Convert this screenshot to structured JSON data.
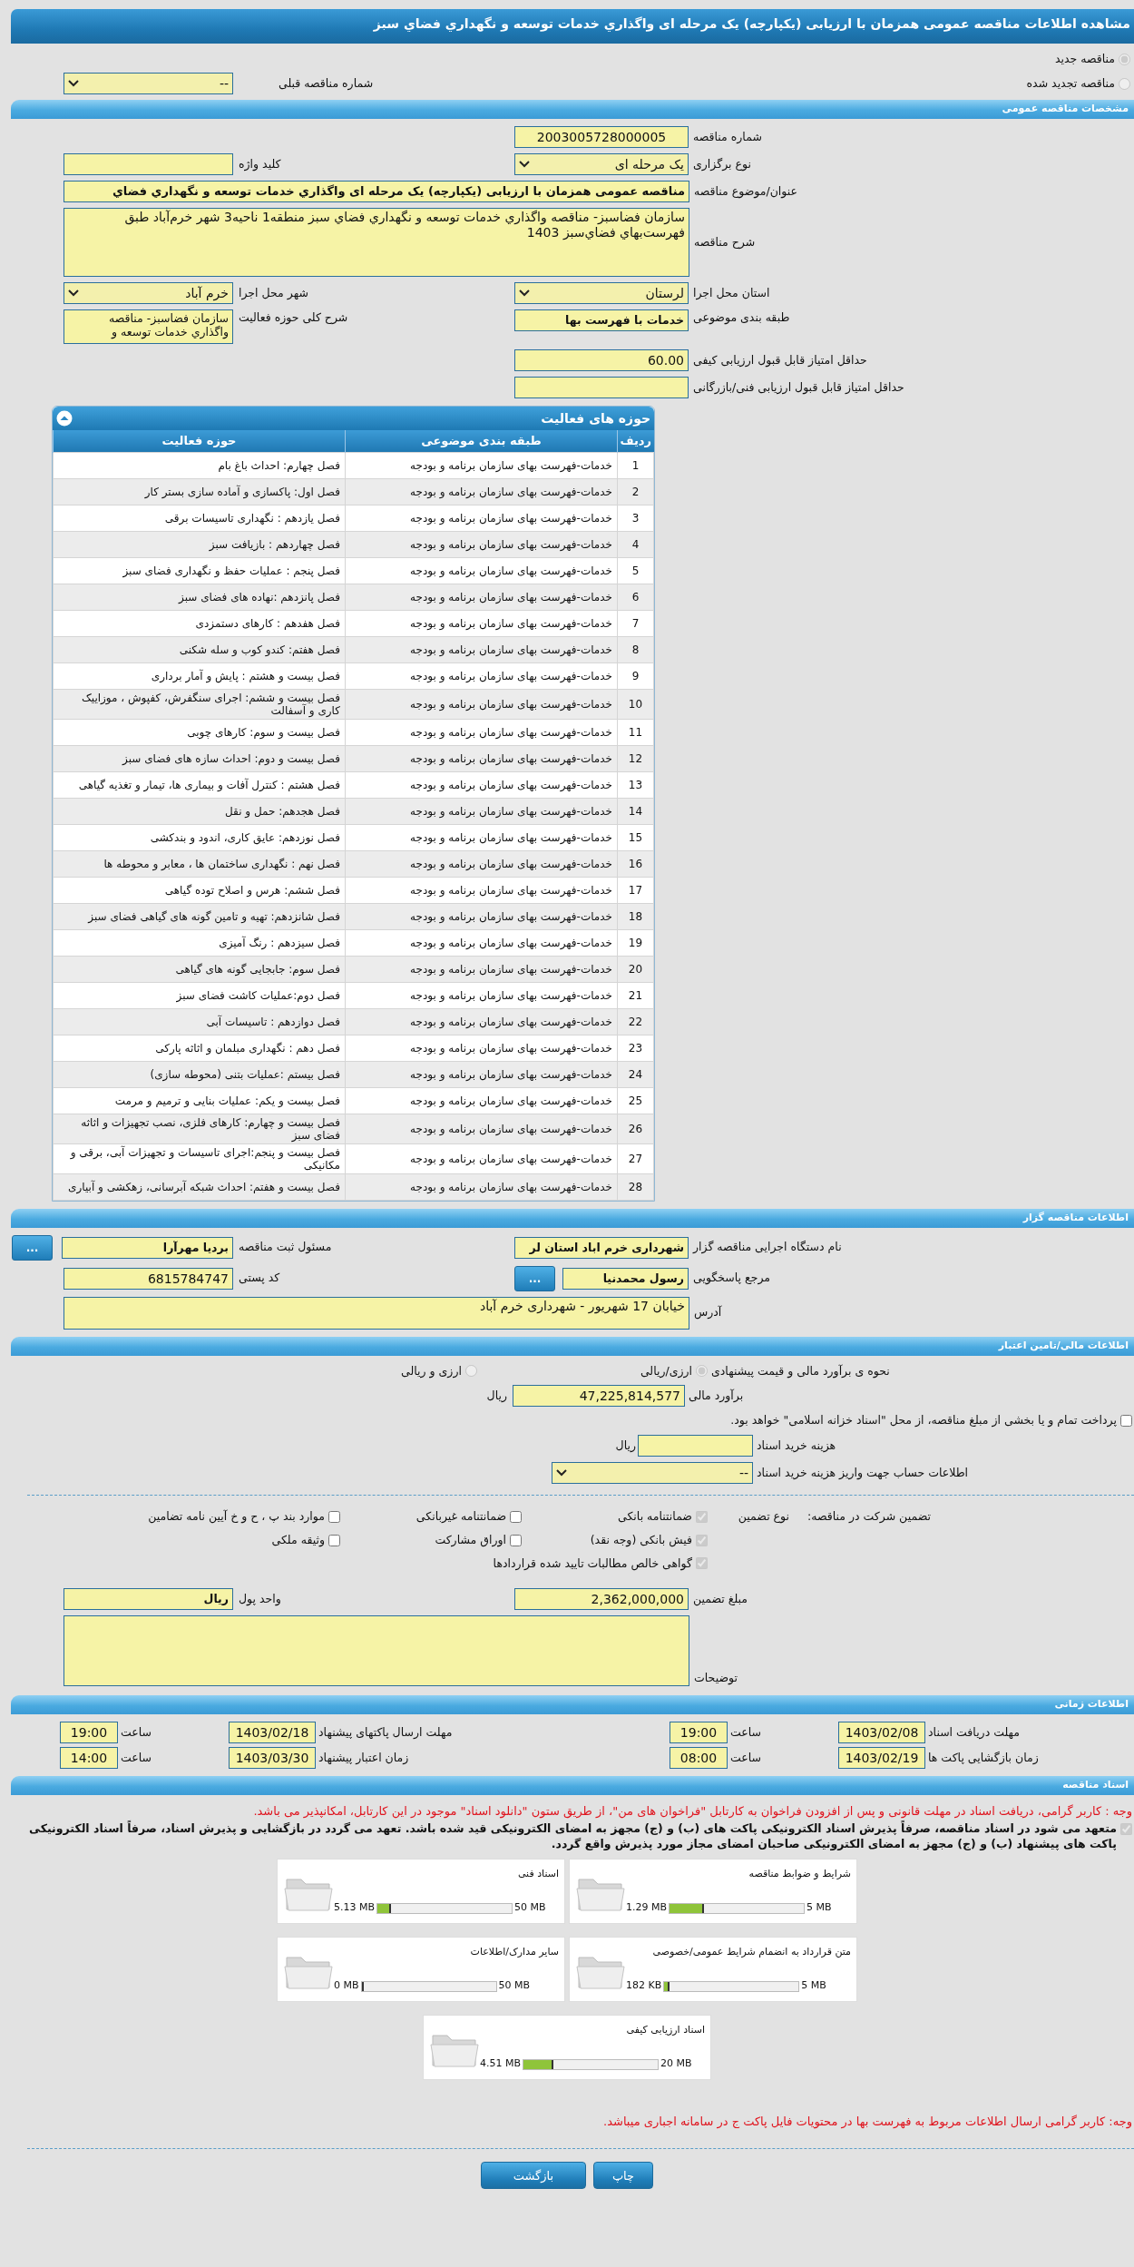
{
  "page_title": "مشاهده اطلاعات مناقصه عمومی همزمان با ارزیابی (یکپارچه) یک مرحله ای واگذاري خدمات توسعه و نگهداري فضاي سبز",
  "tender_type": {
    "options": [
      {
        "label": "مناقصه جدید",
        "selected": true
      },
      {
        "label": "مناقصه تجدید شده",
        "selected": false
      }
    ],
    "previous_tender": {
      "label": "شماره مناقصه قبلی",
      "value": "--"
    }
  },
  "general": {
    "heading": "مشخصات مناقصه عمومی",
    "rows": [
      {
        "cells": [
          {
            "label": "شماره مناقصه",
            "kind": "id",
            "value": "2003005728000005"
          }
        ]
      },
      {
        "cells": [
          {
            "label": "نوع برگزاری",
            "kind": "select",
            "value": "یک مرحله ای"
          },
          {
            "label": "کلید واژه",
            "kind": "input"
          }
        ]
      },
      {
        "cells": [
          {
            "label": "عنوان/موضوع مناقصه",
            "kind": "long_input",
            "bold": true,
            "value": "مناقصه عمومی همزمان با ارزیابی (یکپارچه) یک مرحله ای واگذاري خدمات توسعه و نگهداري فضاي"
          }
        ]
      },
      {
        "cells": [
          {
            "label": "شرح مناقصه",
            "kind": "long_memo",
            "value": "سازمان فضاسبز- مناقصه واگذاري خدمات توسعه و نگهداري فضاي سبز منطقه1 ناحیه3 شهر خرم‌آباد طبق فهرست‌بهاي فضاي‌سبز 1403"
          }
        ]
      },
      {
        "cells": [
          {
            "label": "استان محل اجرا",
            "kind": "select",
            "value": "لرستان"
          },
          {
            "label": "شهر محل اجرا",
            "kind": "select",
            "value": "خرم آباد"
          }
        ]
      },
      {
        "cells": [
          {
            "label": "طبقه بندی موضوعی",
            "kind": "input",
            "bold": true,
            "value": "خدمات با فهرست بها"
          },
          {
            "label": "شرح کلی حوزه فعالیت",
            "kind": "memo",
            "value": "سازمان فضاسبز- مناقصه واگذاري خدمات توسعه و"
          }
        ]
      },
      {
        "cells": [
          {
            "label": "حداقل امتیاز قابل قبول ارزیابی کیفی",
            "kind": "number",
            "value": "60.00"
          }
        ]
      },
      {
        "cells": [
          {
            "label": "حداقل امتیاز قابل قبول ارزیابی فنی/بازرگانی",
            "kind": "input"
          }
        ]
      }
    ]
  },
  "activities": {
    "title": "حوزه های فعالیت",
    "columns": [
      "ردیف",
      "طبقه بندی موضوعی",
      "حوزه فعالیت"
    ],
    "rows": [
      [
        "1",
        "خدمات-فهرست بهای سازمان برنامه و بودجه",
        "فصل چهارم: احداث باغ بام"
      ],
      [
        "2",
        "خدمات-فهرست بهای سازمان برنامه و بودجه",
        "فصل اول:  پاکسازی و آماده سازی بستر کار"
      ],
      [
        "3",
        "خدمات-فهرست بهای سازمان برنامه و بودجه",
        "فصل یازدهم : نگهداری تاسیسات برقی"
      ],
      [
        "4",
        "خدمات-فهرست بهای سازمان برنامه و بودجه",
        "فصل چهاردهم : بازیافت سبز"
      ],
      [
        "5",
        "خدمات-فهرست بهای سازمان برنامه و بودجه",
        "فصل پنجم : عملیات حفظ و نگهداری فضای سبز"
      ],
      [
        "6",
        "خدمات-فهرست بهای سازمان برنامه و بودجه",
        "فصل پانزدهم :نهاده های فضای سبز"
      ],
      [
        "7",
        "خدمات-فهرست بهای سازمان برنامه و بودجه",
        "فصل هفدهم : کارهای دستمزدی"
      ],
      [
        "8",
        "خدمات-فهرست بهای سازمان برنامه و بودجه",
        "فصل هفتم: کندو کوب و سله شکنی"
      ],
      [
        "9",
        "خدمات-فهرست بهای سازمان برنامه و بودجه",
        "فصل بیست و هشتم : پایش و آمار برداری"
      ],
      [
        "10",
        "خدمات-فهرست بهای سازمان برنامه و بودجه",
        "فصل بیست و ششم: اجرای سنگفرش، کفپوش ، موزاییک کاری و آسفالت"
      ],
      [
        "11",
        "خدمات-فهرست بهای سازمان برنامه و بودجه",
        "فصل بیست و سوم: کارهای چوبی"
      ],
      [
        "12",
        "خدمات-فهرست بهای سازمان برنامه و بودجه",
        "فصل بیست و دوم: احداث سازه های فضای سبز"
      ],
      [
        "13",
        "خدمات-فهرست بهای سازمان برنامه و بودجه",
        "فصل هشتم : کنترل آفات و بیماری ها، تیمار و تغذیه گیاهی"
      ],
      [
        "14",
        "خدمات-فهرست بهای سازمان برنامه و بودجه",
        "فصل هجدهم: حمل و نقل"
      ],
      [
        "15",
        "خدمات-فهرست بهای سازمان برنامه و بودجه",
        "فصل نوزدهم: عایق کاری، اندود و بندکشی"
      ],
      [
        "16",
        "خدمات-فهرست بهای سازمان برنامه و بودجه",
        "فصل نهم : نگهداری ساختمان ها ، معابر و محوطه ها"
      ],
      [
        "17",
        "خدمات-فهرست بهای سازمان برنامه و بودجه",
        "فصل ششم: هرس و اصلاح توده گیاهی"
      ],
      [
        "18",
        "خدمات-فهرست بهای سازمان برنامه و بودجه",
        "فصل شانزدهم: تهیه و تامین گونه های گیاهی فضای سبز"
      ],
      [
        "19",
        "خدمات-فهرست بهای سازمان برنامه و بودجه",
        "فصل سیزدهم : رنگ آمیزی"
      ],
      [
        "20",
        "خدمات-فهرست بهای سازمان برنامه و بودجه",
        "فصل سوم: جابجایی گونه های گیاهی"
      ],
      [
        "21",
        "خدمات-فهرست بهای سازمان برنامه و بودجه",
        "فصل دوم:عملیات کاشت فضای سبز"
      ],
      [
        "22",
        "خدمات-فهرست بهای سازمان برنامه و بودجه",
        "فصل دوازدهم : تاسیسات آبی"
      ],
      [
        "23",
        "خدمات-فهرست بهای سازمان برنامه و بودجه",
        "فصل دهم : نگهداری مبلمان و اثاثه پارکی"
      ],
      [
        "24",
        "خدمات-فهرست بهای سازمان برنامه و بودجه",
        "فصل بیستم :عملیات بتنی (محوطه سازی)"
      ],
      [
        "25",
        "خدمات-فهرست بهای سازمان برنامه و بودجه",
        "فصل بیست و یکم: عملیات بنایی و ترمیم و مرمت"
      ],
      [
        "26",
        "خدمات-فهرست بهای سازمان برنامه و بودجه",
        "فصل بیست و چهارم: کارهای فلزی، نصب تجهیزات و اثاثه فضای سبز"
      ],
      [
        "27",
        "خدمات-فهرست بهای سازمان برنامه و بودجه",
        "فصل بیست و پنجم:اجرای تاسیسات و تجهیزات آبی، برقی و مکانیکی"
      ],
      [
        "28",
        "خدمات-فهرست بهای سازمان برنامه و بودجه",
        "فصل بیست و هفتم: احداث شبکه آبرسانی، زهکشی و آبیاری"
      ]
    ]
  },
  "organizer": {
    "heading": "اطلاعات مناقصه گزار",
    "rows": [
      {
        "cells": [
          {
            "label": "نام دستگاه اجرایی مناقصه گزار",
            "kind": "input",
            "bold": true,
            "value": "شهرداری خرم اباد استان لر"
          },
          {
            "label": "مسئول ثبت مناقصه",
            "kind": "input",
            "bold": true,
            "value": "بردیا مهرآرا",
            "button": "..."
          }
        ]
      },
      {
        "cells": [
          {
            "label": "مرجع پاسخگویی",
            "kind": "input",
            "bold": true,
            "value": "رسول محمدنیا",
            "button": "..."
          },
          {
            "label": "کد پستی",
            "kind": "number",
            "value": "6815784747"
          }
        ]
      },
      {
        "cells": [
          {
            "label": "آدرس",
            "kind": "address",
            "value": "خیابان 17 شهریور - شهرداری خرم آباد"
          }
        ]
      }
    ]
  },
  "finance": {
    "heading": "اطلاعات مالی/تامین اعتبار",
    "method": {
      "label": "نحوه ی برآورد مالی و قیمت پیشنهادی",
      "options": [
        {
          "label": "ارزی/ریالی",
          "selected": true
        },
        {
          "label": "ارزی و ریالی",
          "selected": false
        }
      ]
    },
    "estimate": {
      "label": "برآورد مالی",
      "value": "47,225,814,577",
      "unit": "ریال"
    },
    "treasury": {
      "label": "پرداخت تمام و یا بخشی از مبلغ مناقصه، از محل \"اسناد خزانه اسلامی\" خواهد بود.",
      "checked": false
    },
    "doc_fee": {
      "label": "هزینه خرید اسناد",
      "unit": "ریال"
    },
    "account": {
      "label": "اطلاعات حساب جهت واریز هزینه خرید اسناد",
      "value": "--"
    },
    "guarantee": {
      "label": "تضمین شرکت در مناقصه:",
      "type_label": "نوع تضمین",
      "columns": [
        {
          "items": [
            {
              "label": "ضمانتنامه بانکی",
              "checked": true
            },
            {
              "label": "فیش بانکی (وجه نقد)",
              "checked": true
            },
            {
              "label": "گواهی خالص مطالبات تایید شده قراردادها",
              "checked": true
            }
          ]
        },
        {
          "items": [
            {
              "label": "ضمانتنامه غیربانکی",
              "checked": false
            },
            {
              "label": "اوراق مشارکت",
              "checked": false
            }
          ]
        },
        {
          "items": [
            {
              "label": "موارد بند پ ، ح و خ آیین نامه تضامین",
              "checked": false
            },
            {
              "label": "وثیقه ملکی",
              "checked": false
            }
          ]
        }
      ]
    },
    "rows": [
      {
        "cells": [
          {
            "label": "مبلغ تضمین",
            "kind": "number",
            "value": "2,362,000,000"
          },
          {
            "label": "واحد پول",
            "kind": "input",
            "bold": true,
            "value": "ریال"
          }
        ]
      },
      {
        "cells": [
          {
            "label": "توضیحات",
            "kind": "notes"
          }
        ]
      }
    ]
  },
  "schedule": {
    "heading": "اطلاعات زمانی",
    "rows": [
      {
        "entries": [
          {
            "label": "مهلت دریافت اسناد",
            "date": "1403/02/08",
            "time_label": "ساعت",
            "time": "19:00"
          },
          {
            "label": "مهلت ارسال پاکتهای پیشنهاد",
            "date": "1403/02/18",
            "time_label": "ساعت",
            "time": "19:00"
          }
        ]
      },
      {
        "entries": [
          {
            "label": "زمان بازگشایی پاکت ها",
            "date": "1403/02/19",
            "time_label": "ساعت",
            "time": "08:00"
          },
          {
            "label": "زمان اعتبار پیشنهاد",
            "date": "1403/03/30",
            "time_label": "ساعت",
            "time": "14:00"
          }
        ]
      }
    ]
  },
  "documents": {
    "heading": "اسناد مناقصه",
    "notice": "وجه : کاربر گرامی، دریافت اسناد در مهلت قانونی و پس از افزودن فراخوان به کارتابل \"فراخوان های من\"، از طریق ستون \"دانلود اسناد\" موجود در این کارتابل، امکانپذیر می باشد.",
    "pledge": {
      "text": "متعهد می شود در اسناد مناقصه، صرفاً پذیرش اسناد الکترونیکی پاکت های (ب) و (ج) مجهز به امضای الکترونیکی قید شده باشد. تعهد می گردد در بازگشایی و پذیرش اسناد، صرفاً اسناد الکترونیکی پاکت های پیشنهاد (ب) و (ج) مجهز به امضای الکترونیکی صاحبان امضای مجاز مورد پذیرش واقع گردد.",
      "checked": true
    },
    "files": [
      {
        "title": "شرایط و ضوابط مناقصه",
        "used": "1.29 MB",
        "limit": "5 MB",
        "level": 0.258
      },
      {
        "title": "اسناد فنی",
        "used": "5.13 MB",
        "limit": "50 MB",
        "level": 0.103
      },
      {
        "title": "متن قرارداد به انضمام شرایط عمومی/خصوصی",
        "used": "182 KB",
        "limit": "5 MB",
        "level": 0.036
      },
      {
        "title": "سایر مدارک/اطلاعات",
        "used": "0 MB",
        "limit": "50 MB",
        "level": 0
      },
      {
        "title": "اسناد ارزیابی کیفی",
        "used": "4.51 MB",
        "limit": "20 MB",
        "level": 0.226
      }
    ],
    "footer_notice": "وجه: کاربر گرامی ارسال اطلاعات مربوط به فهرست بها در محتویات فایل پاکت ج در سامانه اجباری میباشد."
  },
  "actions": [
    {
      "label": "چاپ",
      "kind": "print"
    },
    {
      "label": "بازگشت",
      "kind": "back"
    }
  ]
}
